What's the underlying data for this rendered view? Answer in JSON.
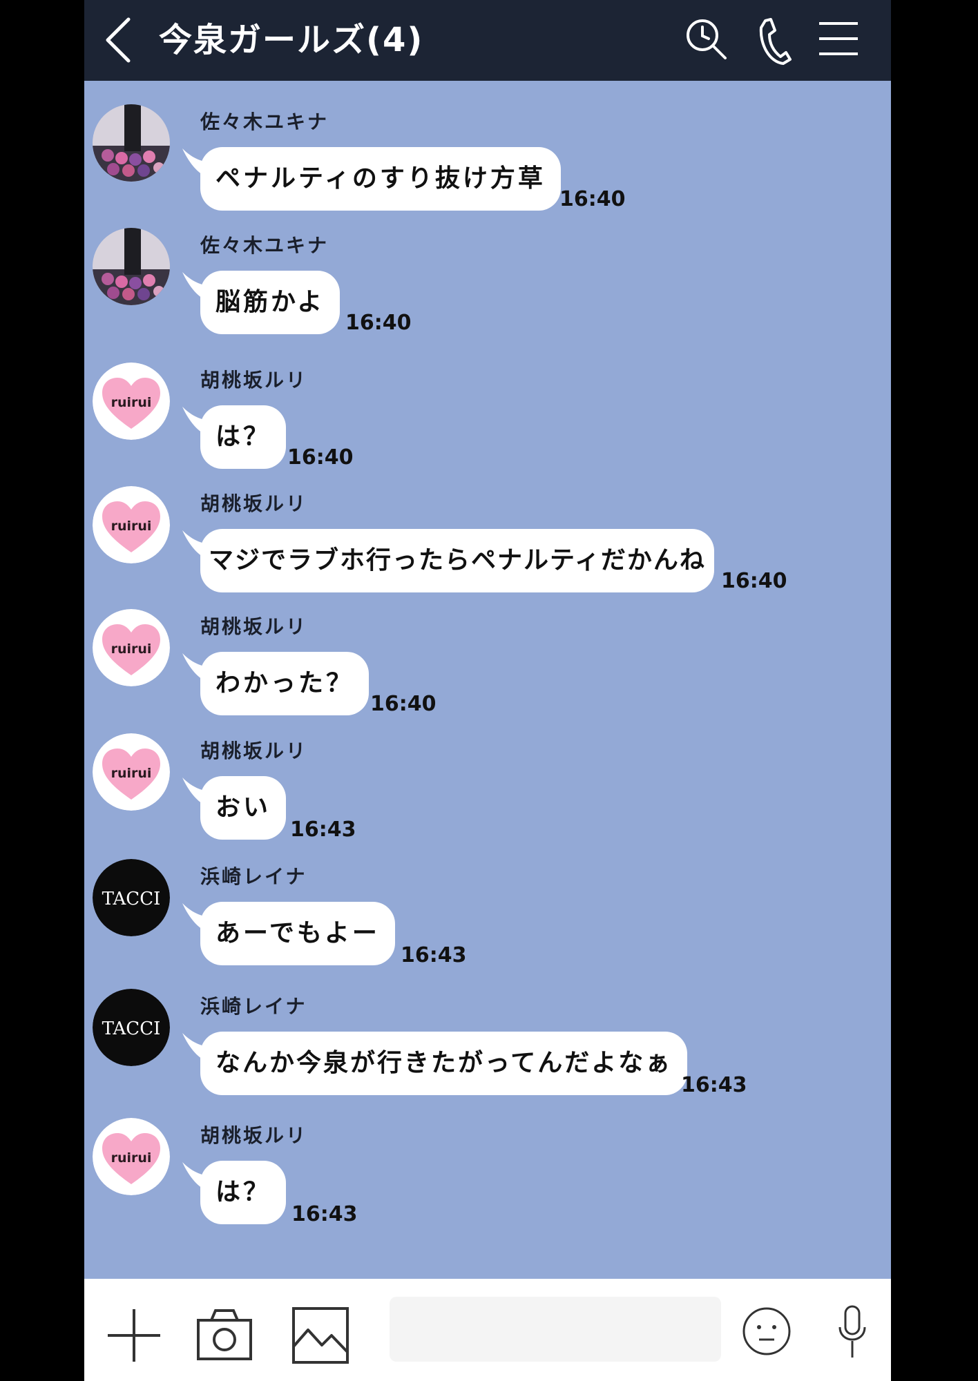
{
  "header": {
    "back_icon": "chevron-left-icon",
    "title": "今泉ガールズ(4)",
    "actions": [
      "search-icon",
      "phone-icon",
      "menu-icon"
    ]
  },
  "messages": [
    {
      "sender": "佐々木ユキナ",
      "text": "ペナルティのすり抜け方草",
      "time": "16:40",
      "avatar": "makeup-palette"
    },
    {
      "sender": "佐々木ユキナ",
      "text": "脳筋かよ",
      "time": "16:40",
      "avatar": "makeup-palette"
    },
    {
      "sender": "胡桃坂ルリ",
      "text": "は？",
      "time": "16:40",
      "avatar": "ruirui-heart"
    },
    {
      "sender": "胡桃坂ルリ",
      "text": "マジでラブホ行ったらペナルティだかんね",
      "time": "16:40",
      "avatar": "ruirui-heart"
    },
    {
      "sender": "胡桃坂ルリ",
      "text": "わかった？",
      "time": "16:40",
      "avatar": "ruirui-heart"
    },
    {
      "sender": "胡桃坂ルリ",
      "text": "おい",
      "time": "16:43",
      "avatar": "ruirui-heart"
    },
    {
      "sender": "浜崎レイナ",
      "text": "あーでもよー",
      "time": "16:43",
      "avatar": "tacci-logo"
    },
    {
      "sender": "浜崎レイナ",
      "text": "なんか今泉が行きたがってんだよなぁ",
      "time": "16:43",
      "avatar": "tacci-logo"
    },
    {
      "sender": "胡桃坂ルリ",
      "text": "は？",
      "time": "16:43",
      "avatar": "ruirui-heart"
    }
  ],
  "avatar_labels": {
    "ruirui": "ruirui",
    "tacci": "TACCI"
  },
  "footer": {
    "icons": [
      "plus-icon",
      "camera-icon",
      "image-icon",
      "emoji-icon",
      "microphone-icon"
    ],
    "input_placeholder": ""
  },
  "colors": {
    "chat_background": "#93a9d6",
    "header_background": "#1c2434",
    "bubble": "#ffffff",
    "heart_pink": "#f7a8c8"
  }
}
